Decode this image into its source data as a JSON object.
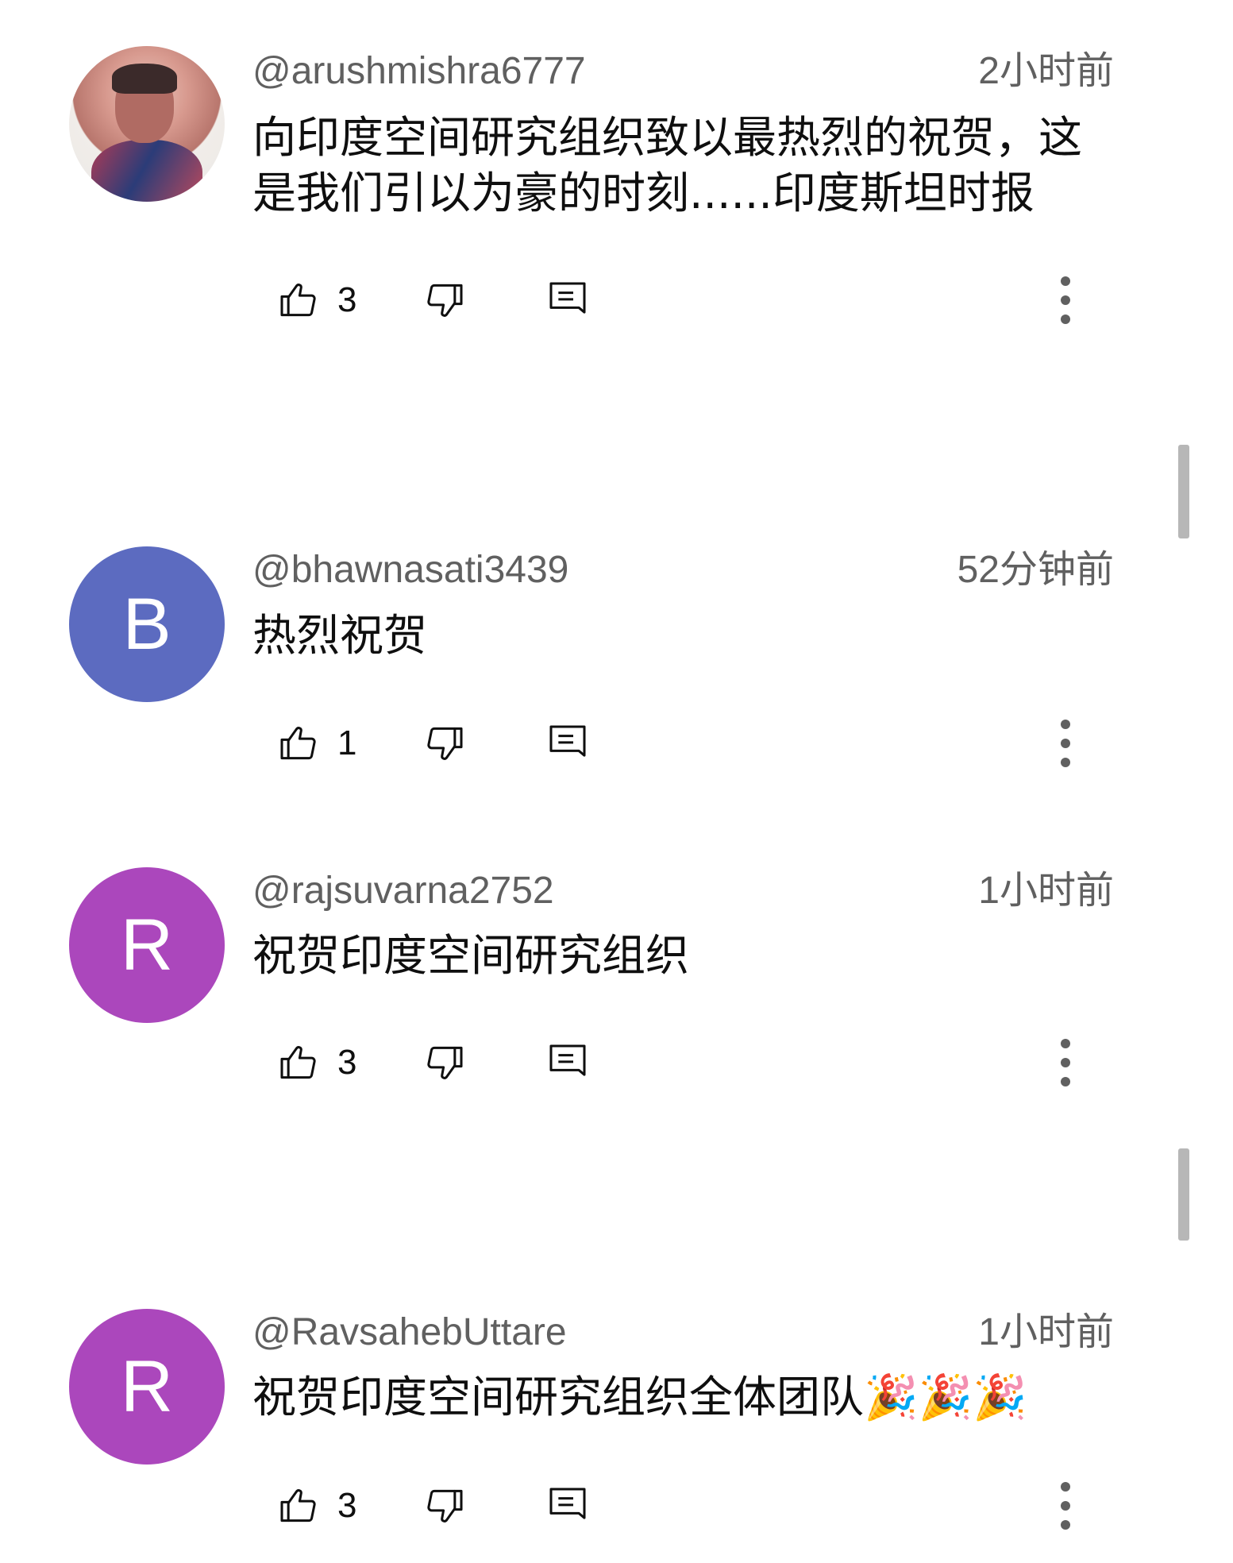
{
  "comments": [
    {
      "username": "@arushmishra6777",
      "time": "2小时前",
      "text": "向印度空间研究组织致以最热烈的祝贺，这是我们引以为豪的时刻......印度斯坦时报",
      "likes": "3",
      "avatar": {
        "type": "photo",
        "letter": ""
      }
    },
    {
      "username": "@bhawnasati3439",
      "time": "52分钟前",
      "text": "热烈祝贺",
      "likes": "1",
      "avatar": {
        "type": "letter",
        "letter": "B",
        "color": "#5c6bc0"
      }
    },
    {
      "username": "@rajsuvarna2752",
      "time": "1小时前",
      "text": "祝贺印度空间研究组织",
      "likes": "3",
      "avatar": {
        "type": "letter",
        "letter": "R",
        "color": "#ab47bc"
      }
    },
    {
      "username": "@RavsahebUttare",
      "time": "1小时前",
      "text": "祝贺印度空间研究组织全体团队🎉🎉🎉",
      "likes": "3",
      "avatar": {
        "type": "letter",
        "letter": "R",
        "color": "#ab47bc"
      }
    }
  ],
  "icons": {
    "like": "thumb-up-icon",
    "dislike": "thumb-down-icon",
    "reply": "reply-icon",
    "more": "more-vertical-icon"
  },
  "colors": {
    "secondary_text": "#606060",
    "primary_text": "#0f0f0f",
    "scrollbar": "#b7b7b7"
  }
}
